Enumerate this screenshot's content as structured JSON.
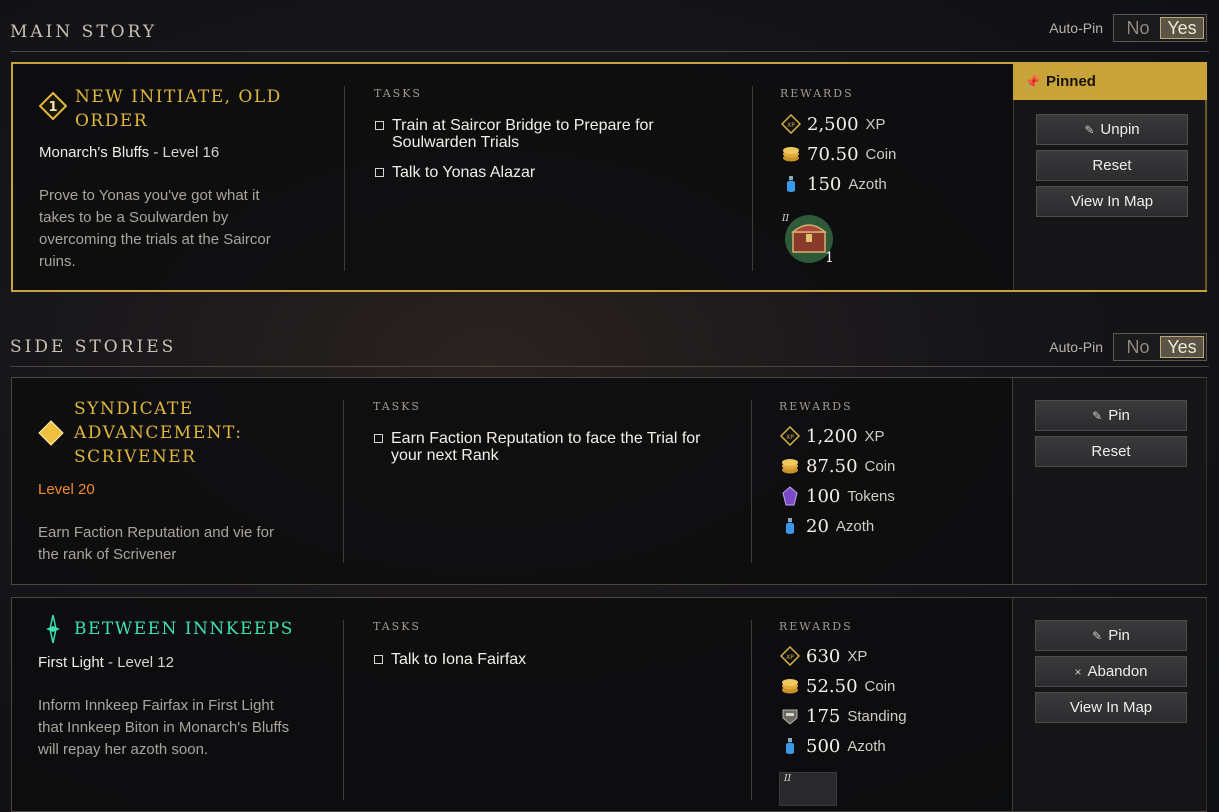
{
  "main_story": {
    "title": "MAIN STORY",
    "autopin": {
      "label": "Auto-Pin",
      "no": "No",
      "yes": "Yes",
      "selected": "Yes"
    },
    "quest": {
      "title": "NEW INITIATE, OLD ORDER",
      "icon": "diamond-number-icon",
      "icon_number": "1",
      "location": "Monarch's Bluffs",
      "level": "- Level 16",
      "description": "Prove to Yonas you've got what it takes to be a Soulwarden by overcoming the trials at the Saircor ruins.",
      "tasks_label": "TASKS",
      "tasks": [
        "Train at Saircor Bridge to Prepare for Soulwarden Trials",
        "Talk to Yonas Alazar"
      ],
      "rewards_label": "REWARDS",
      "rewards": [
        {
          "icon": "xp-icon",
          "amount": "2,500",
          "unit": "XP"
        },
        {
          "icon": "coin-icon",
          "amount": "70.50",
          "unit": "Coin"
        },
        {
          "icon": "azoth-icon",
          "amount": "150",
          "unit": "Azoth"
        }
      ],
      "item_reward": {
        "icon": "chest-icon",
        "tier": "II",
        "count": "1"
      },
      "pinned_label": "Pinned",
      "buttons": [
        "Unpin",
        "Reset",
        "View In Map"
      ]
    }
  },
  "side_stories": {
    "title": "SIDE STORIES",
    "autopin": {
      "label": "Auto-Pin",
      "no": "No",
      "yes": "Yes",
      "selected": "Yes"
    },
    "quests": [
      {
        "title": "SYNDICATE ADVANCEMENT: SCRIVENER",
        "icon": "diamond-icon",
        "location": "Level 20",
        "description": "Earn Faction Reputation and vie for the rank of Scrivener",
        "tasks_label": "TASKS",
        "tasks": [
          "Earn Faction Reputation to face the Trial for your next Rank"
        ],
        "rewards_label": "REWARDS",
        "rewards": [
          {
            "icon": "xp-icon",
            "amount": "1,200",
            "unit": "XP"
          },
          {
            "icon": "coin-icon",
            "amount": "87.50",
            "unit": "Coin"
          },
          {
            "icon": "token-icon",
            "amount": "100",
            "unit": "Tokens"
          },
          {
            "icon": "azoth-icon",
            "amount": "20",
            "unit": "Azoth"
          }
        ],
        "buttons": [
          "Pin",
          "Reset"
        ]
      },
      {
        "title": "BETWEEN INNKEEPS",
        "icon": "star-sparkle-icon",
        "location": "First Light",
        "level": "- Level 12",
        "description": "Inform Innkeep Fairfax in First Light that Innkeep Biton in Monarch's Bluffs will repay her azoth soon.",
        "tasks_label": "TASKS",
        "tasks": [
          "Talk to Iona Fairfax"
        ],
        "rewards_label": "REWARDS",
        "rewards": [
          {
            "icon": "xp-icon",
            "amount": "630",
            "unit": "XP"
          },
          {
            "icon": "coin-icon",
            "amount": "52.50",
            "unit": "Coin"
          },
          {
            "icon": "standing-icon",
            "amount": "175",
            "unit": "Standing"
          },
          {
            "icon": "azoth-icon",
            "amount": "500",
            "unit": "Azoth"
          }
        ],
        "item_reward": {
          "icon": "item-icon",
          "tier": "II"
        },
        "buttons": [
          "Pin",
          "Abandon",
          "View In Map"
        ]
      }
    ]
  },
  "colors": {
    "gold": "#c8a339",
    "title_gold": "#e0b83d",
    "title_green": "#3fe0b0",
    "level_orange": "#f08a2c"
  }
}
